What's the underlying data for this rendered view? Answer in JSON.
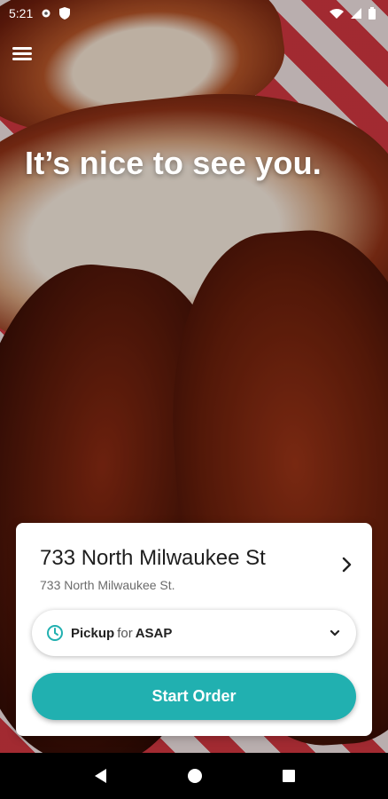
{
  "status_bar": {
    "time": "5:21",
    "icons": [
      "gear-icon",
      "shield-icon",
      "wifi-icon",
      "signal-icon",
      "battery-icon"
    ]
  },
  "header": {
    "menu_icon": "hamburger-menu-icon",
    "headline": "It’s nice to see you."
  },
  "location_card": {
    "title": "733 North Milwaukee St",
    "subtitle": "733 North Milwaukee St.",
    "arrow_icon": "chevron-right-icon",
    "pickup": {
      "icon": "clock-icon",
      "mode": "Pickup",
      "for_text": "for",
      "time": "ASAP",
      "dropdown_icon": "chevron-down-icon"
    },
    "start_button_label": "Start Order"
  },
  "nav_bar": {
    "icons": [
      "back-icon",
      "home-icon",
      "recents-icon"
    ]
  },
  "colors": {
    "accent": "#21b0b0",
    "card_bg": "#ffffff",
    "text_primary": "#1e1e1e",
    "text_secondary": "#6b6b6b"
  }
}
